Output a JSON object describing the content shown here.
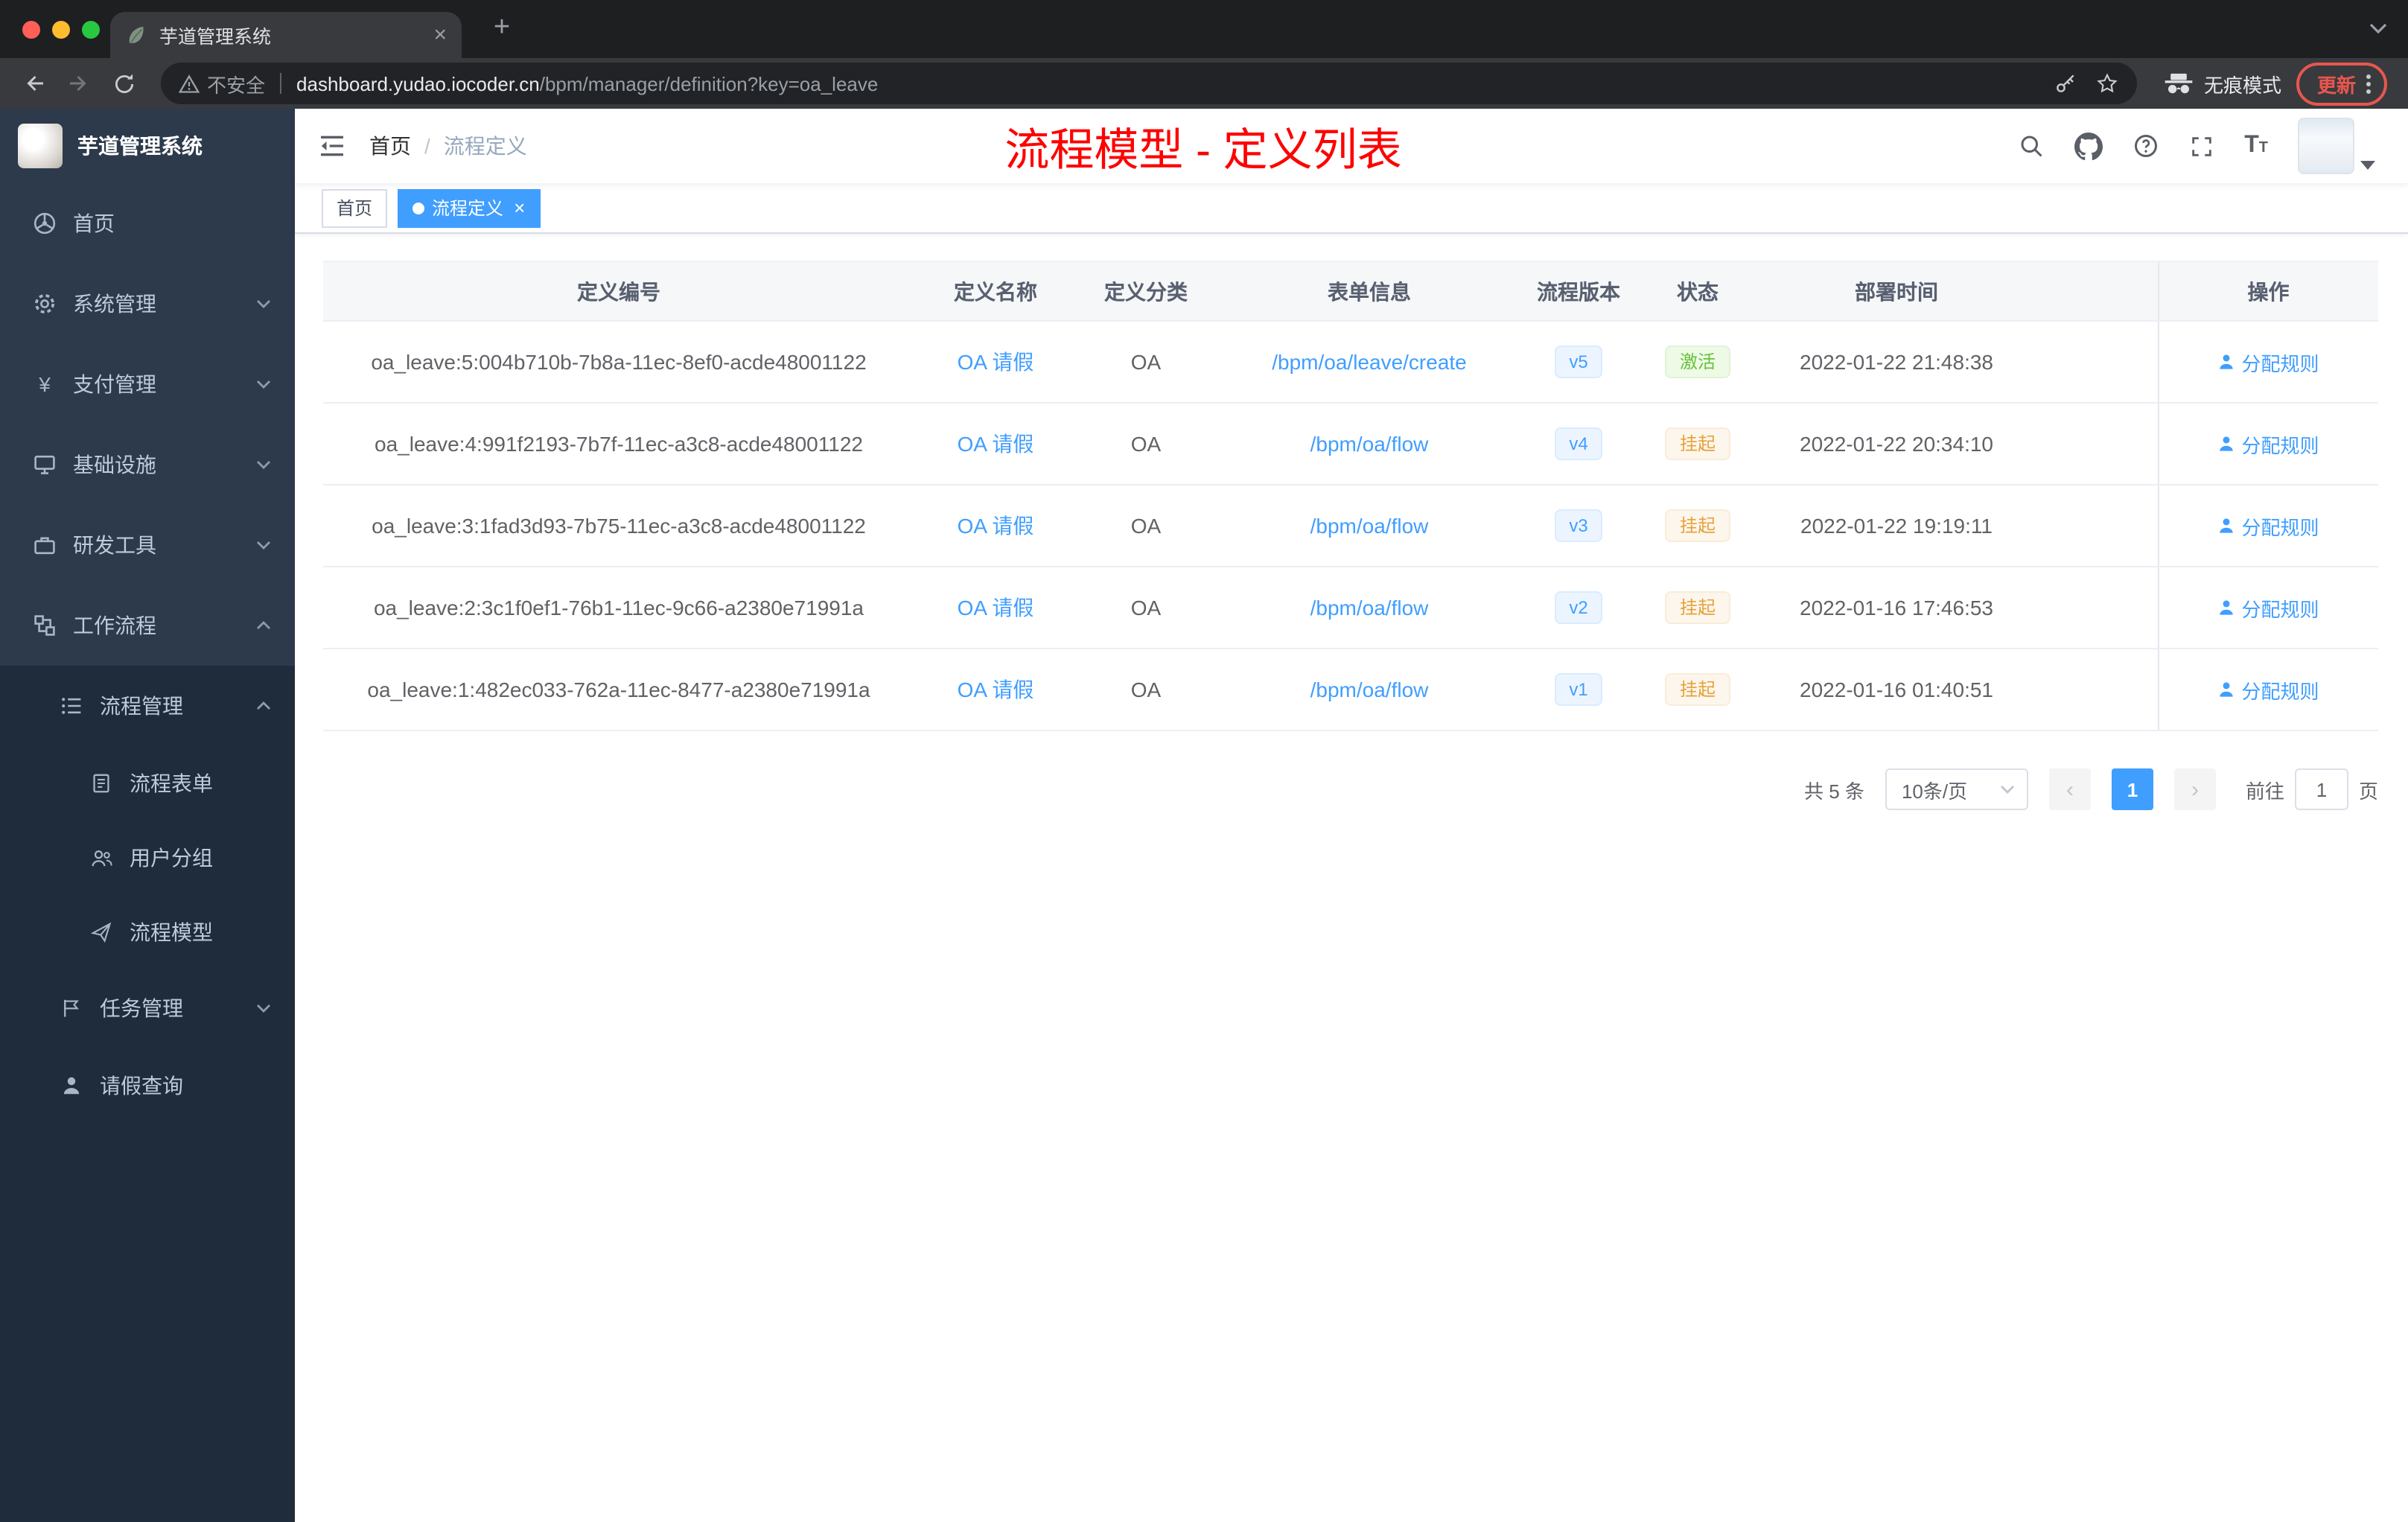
{
  "browser": {
    "tab": {
      "title": "芋道管理系统"
    },
    "address": {
      "security_label": "不安全",
      "domain": "dashboard.yudao.iocoder.cn",
      "path": "/bpm/manager/definition?key=oa_leave",
      "incognito_label": "无痕模式",
      "update_label": "更新"
    }
  },
  "sidebar": {
    "logo_title": "芋道管理系统",
    "items": [
      {
        "label": "首页"
      },
      {
        "label": "系统管理"
      },
      {
        "label": "支付管理"
      },
      {
        "label": "基础设施"
      },
      {
        "label": "研发工具"
      },
      {
        "label": "工作流程"
      }
    ],
    "process_group": {
      "label": "流程管理"
    },
    "process_children": [
      {
        "label": "流程表单"
      },
      {
        "label": "用户分组"
      },
      {
        "label": "流程模型"
      }
    ],
    "task_group": {
      "label": "任务管理"
    },
    "leave_item": {
      "label": "请假查询"
    }
  },
  "header": {
    "breadcrumb": {
      "home": "首页",
      "separator": "/",
      "current": "流程定义"
    },
    "annotation": "流程模型 - 定义列表"
  },
  "tags_view": {
    "tags": [
      {
        "label": "首页"
      },
      {
        "label": "流程定义"
      }
    ]
  },
  "table": {
    "columns": [
      "定义编号",
      "定义名称",
      "定义分类",
      "表单信息",
      "流程版本",
      "状态",
      "部署时间",
      "操作"
    ],
    "rows": [
      {
        "id": "oa_leave:5:004b710b-7b8a-11ec-8ef0-acde48001122",
        "name": "OA 请假",
        "category": "OA",
        "form": "/bpm/oa/leave/create",
        "version": "v5",
        "status": "激活",
        "deployed": "2022-01-22 21:48:38",
        "action": "分配规则"
      },
      {
        "id": "oa_leave:4:991f2193-7b7f-11ec-a3c8-acde48001122",
        "name": "OA 请假",
        "category": "OA",
        "form": "/bpm/oa/flow",
        "version": "v4",
        "status": "挂起",
        "deployed": "2022-01-22 20:34:10",
        "action": "分配规则"
      },
      {
        "id": "oa_leave:3:1fad3d93-7b75-11ec-a3c8-acde48001122",
        "name": "OA 请假",
        "category": "OA",
        "form": "/bpm/oa/flow",
        "version": "v3",
        "status": "挂起",
        "deployed": "2022-01-22 19:19:11",
        "action": "分配规则"
      },
      {
        "id": "oa_leave:2:3c1f0ef1-76b1-11ec-9c66-a2380e71991a",
        "name": "OA 请假",
        "category": "OA",
        "form": "/bpm/oa/flow",
        "version": "v2",
        "status": "挂起",
        "deployed": "2022-01-16 17:46:53",
        "action": "分配规则"
      },
      {
        "id": "oa_leave:1:482ec033-762a-11ec-8477-a2380e71991a",
        "name": "OA 请假",
        "category": "OA",
        "form": "/bpm/oa/flow",
        "version": "v1",
        "status": "挂起",
        "deployed": "2022-01-16 01:40:51",
        "action": "分配规则"
      }
    ]
  },
  "pagination": {
    "total": "共 5 条",
    "page_size": "10条/页",
    "current_page": "1",
    "goto_label": "前往",
    "goto_value": "1",
    "page_unit": "页"
  },
  "colors": {
    "accent": "#409eff",
    "success": "#67c23a",
    "warning": "#e6a23c",
    "annotation_red": "#fe0100",
    "sidebar_bg": "#2d3a4b",
    "sidebar_sub_bg": "#1f2c3c",
    "active_tag_bg": "#409eff"
  }
}
